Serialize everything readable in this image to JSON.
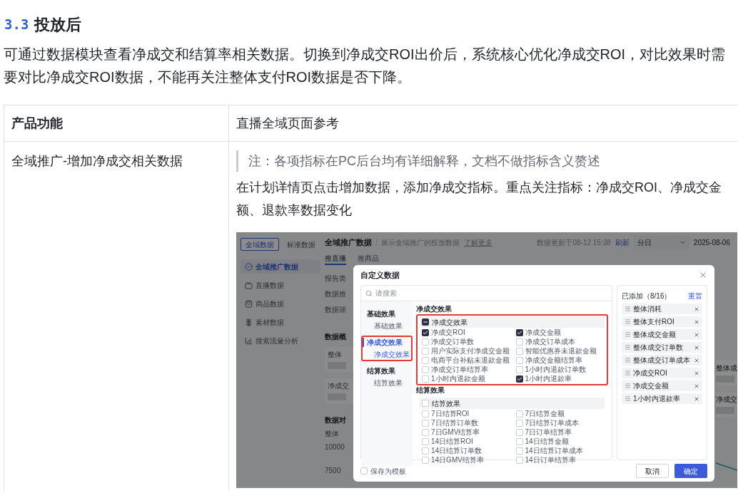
{
  "section": {
    "number": "3.3",
    "title": "投放后"
  },
  "intro": "可通过数据模块查看净成交和结算率相关数据。切换到净成交ROI出价后，系统核心优化净成交ROI，对比效果时需要对比净成交ROI数据，不能再关注整体支付ROI数据是否下降。",
  "table": {
    "columns": [
      "产品功能",
      "直播全域页面参考"
    ],
    "rows": [
      {
        "feature": "全域推广-增加净成交相关数据",
        "note": "注：各项指标在PC后台均有详细解释，文档不做指标含义赘述",
        "description": "在计划详情页点击增加数据，添加净成交指标。重点关注指标：净成交ROI、净成交金额、退款率数据变化",
        "screenshot": {
          "data_tabs": [
            {
              "label": "全域数据",
              "selected": true
            },
            {
              "label": "标准数据",
              "selected": false
            }
          ],
          "nav": [
            {
              "label": "全域推广数据",
              "kind": "check",
              "selected": true
            },
            {
              "label": "直播数据",
              "kind": "tv",
              "selected": false
            },
            {
              "label": "商品数据",
              "kind": "bag",
              "selected": false
            },
            {
              "label": "素材数据",
              "kind": "flower",
              "selected": false
            },
            {
              "label": "搜索流量分析",
              "kind": "chart",
              "selected": false
            }
          ],
          "header": {
            "title": "全域推广数据",
            "subtitle": "展示全域推广的投放数据",
            "link": "了解更多",
            "updated": "数据更新于08-12 15:38",
            "refresh": "刷新",
            "granularity": "分日",
            "date": "2025-08-06"
          },
          "tabs": [
            {
              "label": "推直播",
              "selected": true
            },
            {
              "label": "推商品",
              "selected": false
            }
          ],
          "labels": [
            "报告类",
            "数据推",
            "数据筛"
          ],
          "overview_title": "数据概",
          "cards": [
            {
              "label": "整体"
            },
            {
              "label": "净成交"
            }
          ],
          "compare_title": "数据对",
          "chart_labels": [
            "整体",
            "10000",
            "7500"
          ],
          "right_cards": [
            {
              "label": "整体成"
            },
            {
              "label": "净成交"
            }
          ],
          "dialog": {
            "title": "自定义数据",
            "search_placeholder": "请搜索",
            "categories": [
              {
                "label": "基础效果",
                "selected": false,
                "highlighted": false,
                "children": [
                  {
                    "label": "基础效果",
                    "selected": false
                  }
                ]
              },
              {
                "label": "净成交效果",
                "selected": true,
                "highlighted": true,
                "children": [
                  {
                    "label": "净成交效果",
                    "selected": true
                  }
                ]
              },
              {
                "label": "结算效果",
                "selected": false,
                "highlighted": false,
                "children": [
                  {
                    "label": "结算效果",
                    "selected": false
                  }
                ]
              }
            ],
            "groups": [
              {
                "title": "净成交效果",
                "highlighted": true,
                "group_label": "净成交效果",
                "group_indeterminate": true,
                "items": [
                  {
                    "label": "净成交ROI",
                    "checked": true
                  },
                  {
                    "label": "净成交金额",
                    "checked": true
                  },
                  {
                    "label": "净成交订单数",
                    "checked": false
                  },
                  {
                    "label": "净成交订单成本",
                    "checked": false
                  },
                  {
                    "label": "用户实际支付净成交金额",
                    "checked": false
                  },
                  {
                    "label": "智能优惠券未退款金额",
                    "checked": false
                  },
                  {
                    "label": "电商平台补贴未退款金额",
                    "checked": false
                  },
                  {
                    "label": "净成交金额结算率",
                    "checked": false
                  },
                  {
                    "label": "净成交订单结算率",
                    "checked": false
                  },
                  {
                    "label": "1小时内退款订单数",
                    "checked": false
                  },
                  {
                    "label": "1小时内退款金额",
                    "checked": false
                  },
                  {
                    "label": "1小时内退款率",
                    "checked": true
                  }
                ]
              },
              {
                "title": "结算效果",
                "highlighted": false,
                "group_label": "结算效果",
                "group_indeterminate": false,
                "items": [
                  {
                    "label": "7日结算ROI",
                    "checked": false
                  },
                  {
                    "label": "7日结算金额",
                    "checked": false
                  },
                  {
                    "label": "7日结算订单数",
                    "checked": false
                  },
                  {
                    "label": "7日结算订单成本",
                    "checked": false
                  },
                  {
                    "label": "7日GMV结算率",
                    "checked": false
                  },
                  {
                    "label": "7日订单结算率",
                    "checked": false
                  },
                  {
                    "label": "14日结算ROI",
                    "checked": false
                  },
                  {
                    "label": "14日结算金额",
                    "checked": false
                  },
                  {
                    "label": "14日结算订单数",
                    "checked": false
                  },
                  {
                    "label": "14日结算订单成本",
                    "checked": false
                  },
                  {
                    "label": "14日GMV结算率",
                    "checked": false
                  },
                  {
                    "label": "14日订单结算率",
                    "checked": false
                  }
                ]
              }
            ],
            "added": {
              "title": "已添加（8/16）",
              "reset": "重置",
              "items": [
                "整体消耗",
                "整体支付ROI",
                "整体成交金额",
                "整体成交订单数",
                "整体成交订单成本",
                "净成交ROI",
                "净成交金额",
                "1小时内退款率"
              ]
            },
            "save_template": {
              "label": "保存为模板",
              "checked": false
            },
            "buttons": [
              {
                "label": "取消",
                "kind": "secondary"
              },
              {
                "label": "确定",
                "kind": "primary"
              }
            ]
          }
        }
      }
    ]
  }
}
